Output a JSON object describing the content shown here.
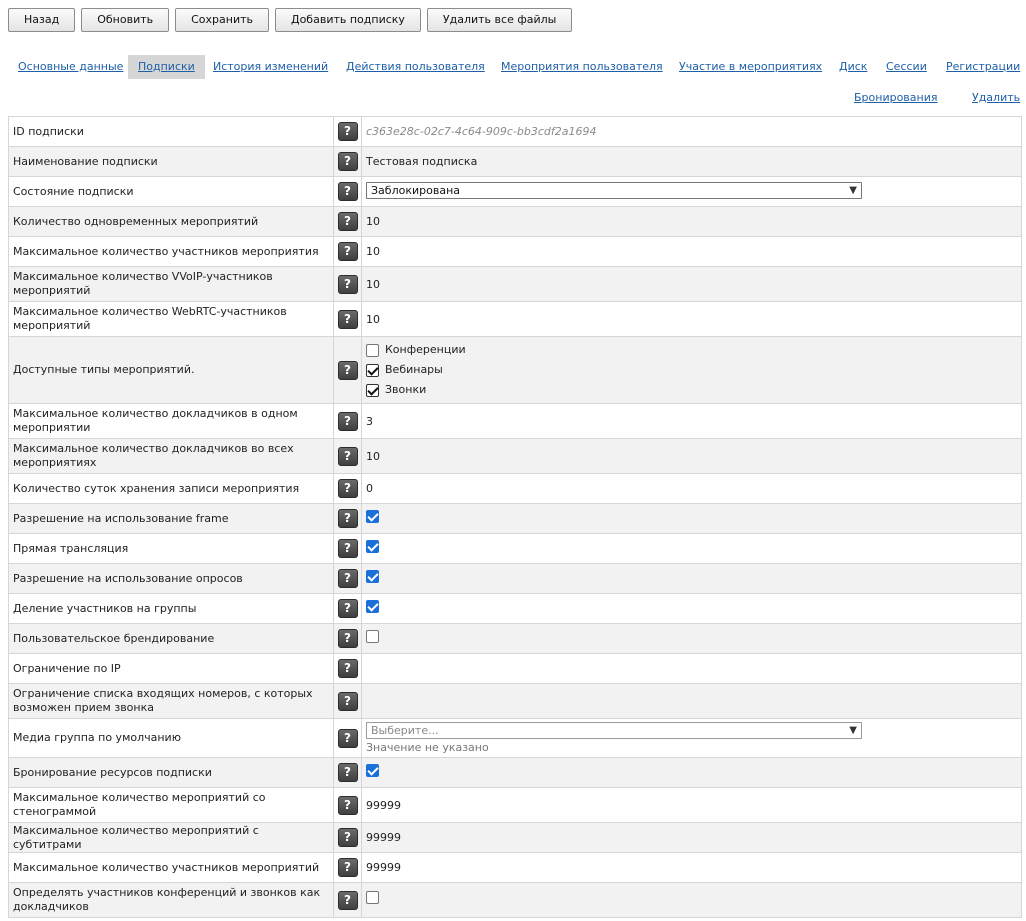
{
  "toolbar": {
    "back": "Назад",
    "refresh": "Обновить",
    "save": "Сохранить",
    "add_subscription": "Добавить подписку",
    "delete_files": "Удалить все файлы"
  },
  "tabs": {
    "row1": [
      "Основные данные",
      "Подписки",
      "История изменений",
      "Действия пользователя",
      "Мероприятия пользователя",
      "Участие в мероприятиях",
      "Диск",
      "Сессии",
      "Регистрации"
    ],
    "row2": [
      "Бронирования",
      "Удалить"
    ],
    "active": "Подписки"
  },
  "help_symbol": "?",
  "fields": {
    "id": {
      "label": "ID подписки",
      "value": "c363e28c-02c7-4c64-909c-bb3cdf2a1694"
    },
    "name": {
      "label": "Наименование подписки",
      "value": "Тестовая подписка"
    },
    "state": {
      "label": "Состояние подписки",
      "value": "Заблокирована"
    },
    "concurrent": {
      "label": "Количество одновременных мероприятий",
      "value": "10"
    },
    "max_participants": {
      "label": "Максимальное количество участников мероприятия",
      "value": "10"
    },
    "max_voip": {
      "label": "Максимальное количество VVoIP-участников мероприятий",
      "value": "10"
    },
    "max_webrtc": {
      "label": "Максимальное количество WebRTC-участников мероприятий",
      "value": "10"
    },
    "types": {
      "label": "Доступные типы мероприятий.",
      "options": [
        {
          "label": "Конференции",
          "checked": false
        },
        {
          "label": "Вебинары",
          "checked": true
        },
        {
          "label": "Звонки",
          "checked": true
        }
      ]
    },
    "speakers_one": {
      "label": "Максимальное количество докладчиков в одном мероприятии",
      "value": "3"
    },
    "speakers_all": {
      "label": "Максимальное количество докладчиков во всех мероприятиях",
      "value": "10"
    },
    "record_days": {
      "label": "Количество суток хранения записи мероприятия",
      "value": "0"
    },
    "frame": {
      "label": "Разрешение на использование frame",
      "checked": true
    },
    "live": {
      "label": "Прямая трансляция",
      "checked": true
    },
    "polls": {
      "label": "Разрешение на использование опросов",
      "checked": true
    },
    "groups": {
      "label": "Деление участников на группы",
      "checked": true
    },
    "branding": {
      "label": "Пользовательское брендирование",
      "checked": false
    },
    "ip_limit": {
      "label": "Ограничение по IP",
      "value": ""
    },
    "inbound": {
      "label": "Ограничение списка входящих номеров, с которых возможен прием звонка",
      "value": ""
    },
    "media_group": {
      "label": "Медиа группа по умолчанию",
      "placeholder": "Выберите...",
      "hint": "Значение не указано"
    },
    "booking": {
      "label": "Бронирование ресурсов подписки",
      "checked": true
    },
    "steno": {
      "label": "Максимальное количество мероприятий со стенограммой",
      "value": "99999"
    },
    "subtitles": {
      "label": "Максимальное количество мероприятий с субтитрами",
      "value": "99999"
    },
    "max_participants2": {
      "label": "Максимальное количество участников мероприятий",
      "value": "99999"
    },
    "as_speakers": {
      "label": "Определять участников конференций и звонков как докладчиков",
      "checked": false
    }
  },
  "colors": {
    "link": "#1f5fa8",
    "checkbox": "#1a6fd8",
    "active_tab": "#d6d6d6"
  }
}
